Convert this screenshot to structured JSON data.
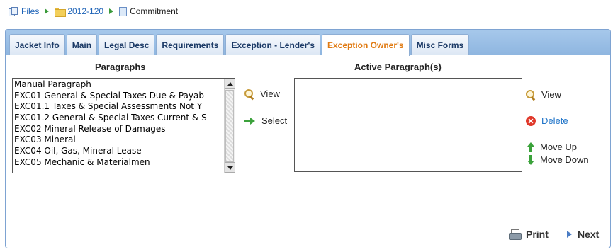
{
  "breadcrumb": {
    "files": "Files",
    "folder": "2012-120",
    "current": "Commitment"
  },
  "tabs": [
    {
      "label": "Jacket Info",
      "active": false
    },
    {
      "label": "Main",
      "active": false
    },
    {
      "label": "Legal Desc",
      "active": false
    },
    {
      "label": "Requirements",
      "active": false
    },
    {
      "label": "Exception - Lender's",
      "active": false
    },
    {
      "label": "Exception Owner's",
      "active": true
    },
    {
      "label": "Misc Forms",
      "active": false
    }
  ],
  "paragraphs": {
    "heading": "Paragraphs",
    "items": [
      "Manual Paragraph",
      "EXC01 General & Special Taxes Due & Payab",
      "EXC01.1 Taxes & Special Assessments Not Y",
      "EXC01.2 General & Special Taxes Current & S",
      "EXC02 Mineral Release of Damages",
      "EXC03 Mineral",
      "EXC04 Oil, Gas, Mineral Lease",
      "EXC05 Mechanic & Materialmen"
    ]
  },
  "active_paragraphs": {
    "heading": "Active Paragraph(s)",
    "items": []
  },
  "actions": {
    "view": "View",
    "select": "Select",
    "view_active": "View",
    "delete": "Delete",
    "move_up": "Move Up",
    "move_down": "Move Down"
  },
  "footer": {
    "print": "Print",
    "next": "Next"
  },
  "colors": {
    "active_tab": "#e07a12",
    "tab_text": "#1b3a66",
    "link": "#1e63b7",
    "delete": "#1e73c8"
  },
  "icons": {
    "files": "files-icon",
    "folder": "folder-icon",
    "document": "document-icon",
    "view": "magnifier-icon",
    "select": "right-arrow-icon",
    "delete": "delete-icon",
    "move_up": "up-arrow-icon",
    "move_down": "down-arrow-icon",
    "print": "printer-icon",
    "next": "play-arrow-icon"
  }
}
